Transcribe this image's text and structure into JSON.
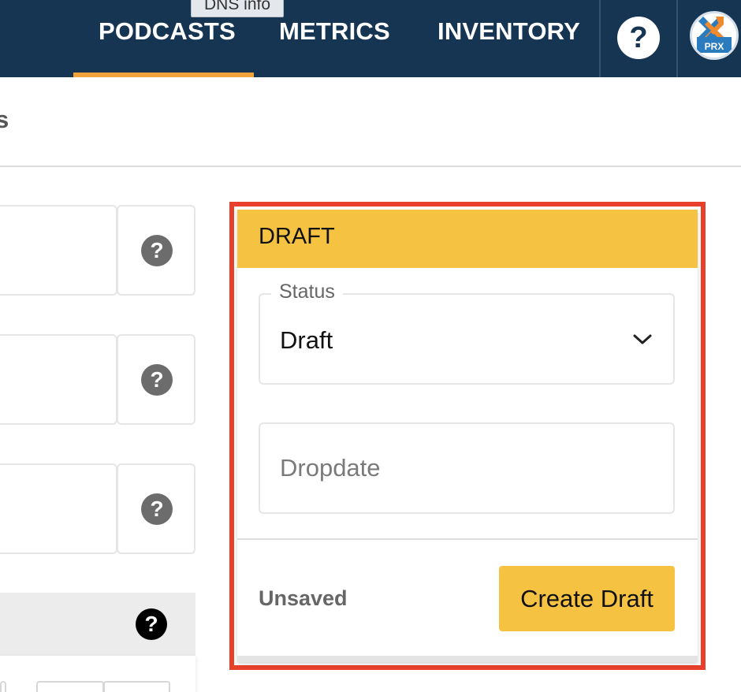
{
  "nav": {
    "tooltip": "DNS info",
    "links": [
      "PODCASTS",
      "METRICS",
      "INVENTORY"
    ],
    "active": "PODCASTS",
    "help_label": "?",
    "avatar_text": "PRX",
    "active_color": "#f1a33b",
    "bar_color": "#163552"
  },
  "page": {
    "heading_fragment": "s"
  },
  "left_fields": {
    "help_label": "?"
  },
  "lower_panel": {
    "help_label": "?"
  },
  "draft": {
    "title": "DRAFT",
    "status_legend": "Status",
    "status_value": "Draft",
    "dropdate_placeholder": "Dropdate",
    "unsaved_label": "Unsaved",
    "create_button": "Create Draft",
    "header_color": "#f5c242",
    "highlight_color": "#e8402a"
  }
}
